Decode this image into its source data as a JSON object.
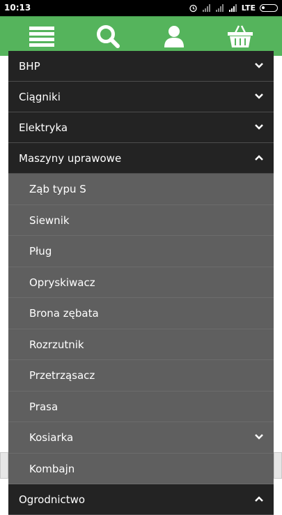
{
  "status_bar": {
    "time": "10:13",
    "network": "LTE",
    "icons": [
      "alarm-icon",
      "signal-icon",
      "signal-icon",
      "signal-icon",
      "battery-icon"
    ]
  },
  "top_nav": {
    "background": "#55b45c",
    "buttons": [
      "menu-icon",
      "search-icon",
      "user-icon",
      "basket-icon"
    ]
  },
  "menu": {
    "categories": [
      {
        "label": "BHP",
        "expanded": false
      },
      {
        "label": "Ciągniki",
        "expanded": false
      },
      {
        "label": "Elektryka",
        "expanded": false
      },
      {
        "label": "Maszyny uprawowe",
        "expanded": true,
        "items": [
          {
            "label": "Ząb typu S"
          },
          {
            "label": "Siewnik"
          },
          {
            "label": "Pług"
          },
          {
            "label": "Opryskiwacz"
          },
          {
            "label": "Brona zębata"
          },
          {
            "label": "Rozrzutnik"
          },
          {
            "label": "Przetrząsacz"
          },
          {
            "label": "Prasa"
          },
          {
            "label": "Kosiarka",
            "has_children": true
          },
          {
            "label": "Kombajn"
          }
        ]
      },
      {
        "label": "Ogrodnictwo",
        "expanded": false
      }
    ]
  }
}
